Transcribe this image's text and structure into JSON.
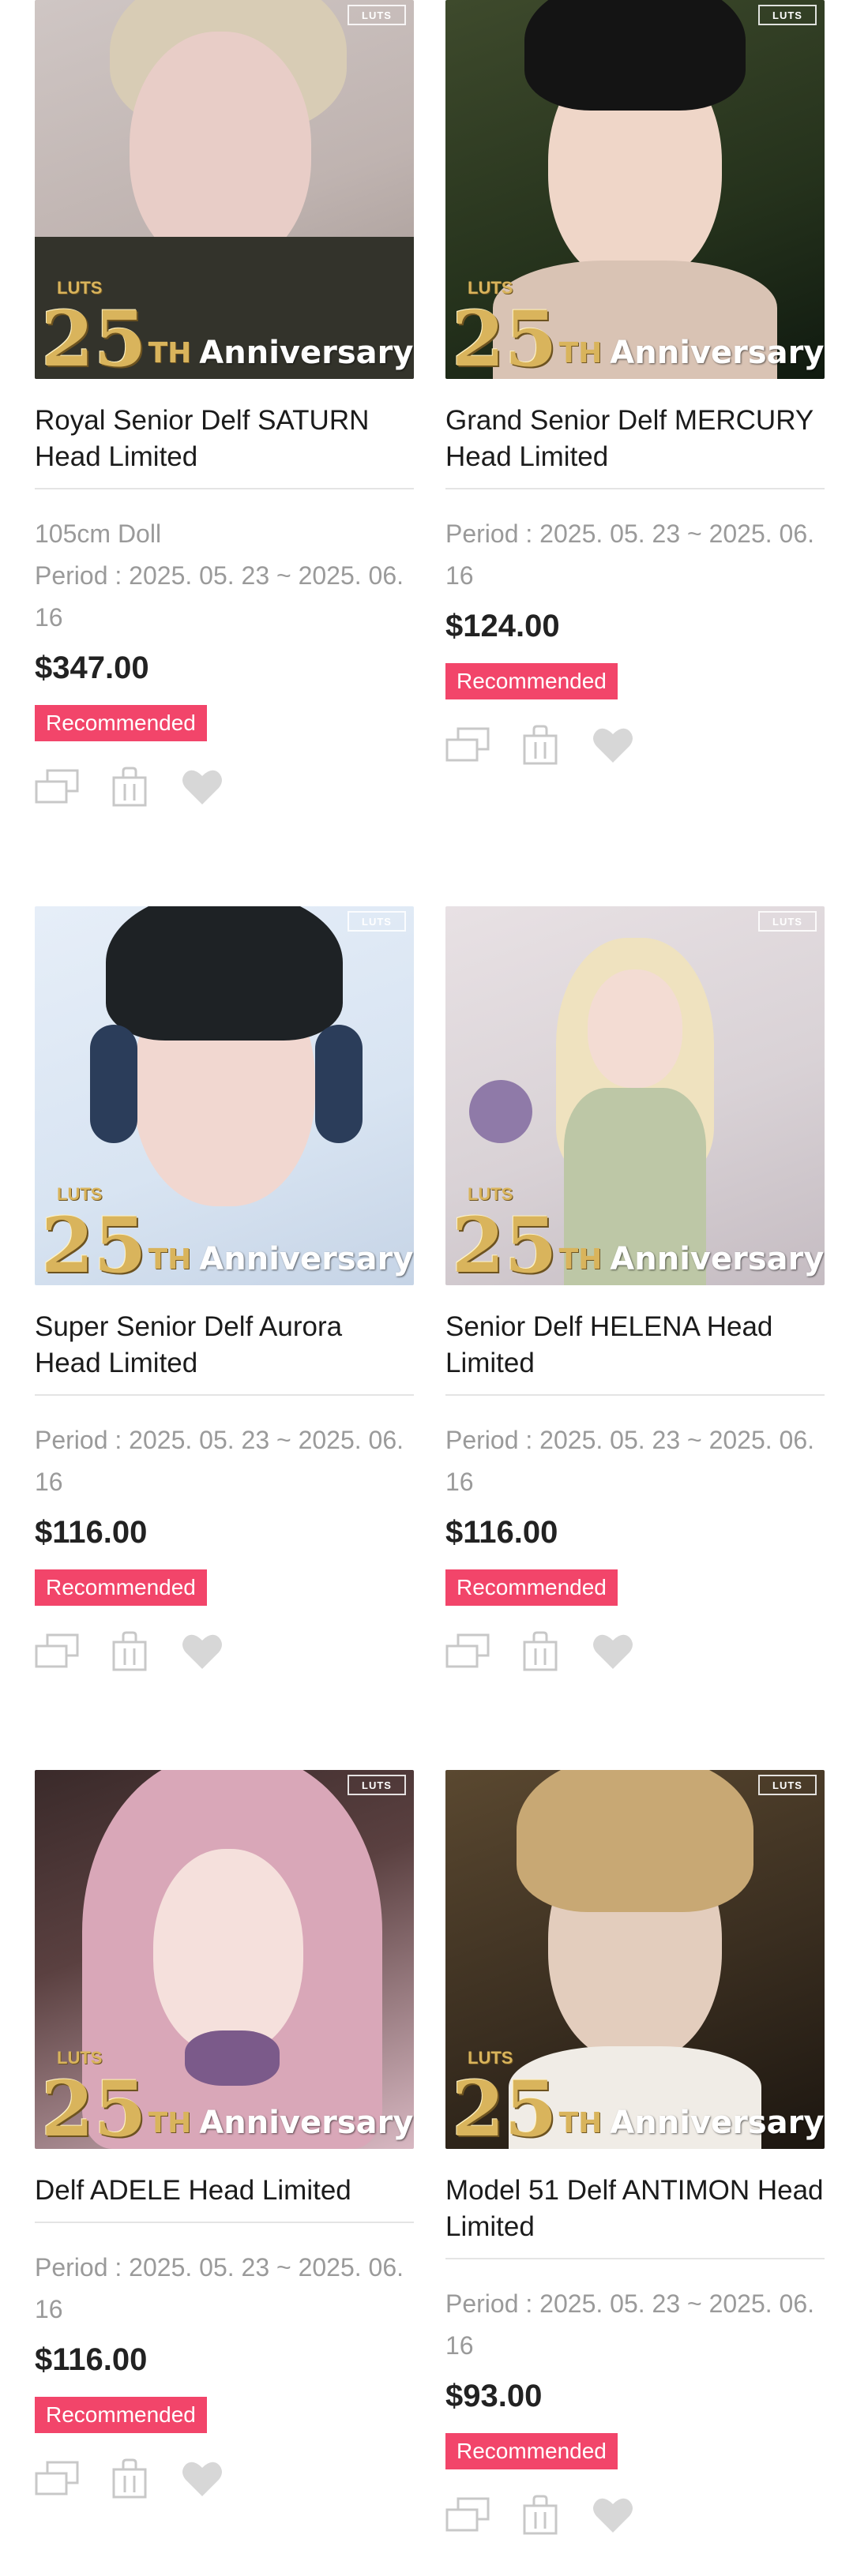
{
  "colors": {
    "recommended_badge": "#f2456a",
    "anniversary_gold": "#d9b45c",
    "icon_gray": "#c8c8c8"
  },
  "products": [
    {
      "name": "Royal Senior Delf SATURN Head Limited",
      "subtitle": "105cm Doll",
      "period": "Period : 2025. 05. 23 ~ 2025. 06. 16",
      "price": "$347.00",
      "badge": "Recommended",
      "image": {
        "brand": "LUTS",
        "anniv_number": "25",
        "anniv_suffix": "TH",
        "anniv_word": "Anniversary",
        "crown": "LUTS"
      }
    },
    {
      "name": "Grand Senior Delf MERCURY Head Limited",
      "period": "Period : 2025. 05. 23 ~ 2025. 06. 16",
      "price": "$124.00",
      "badge": "Recommended",
      "image": {
        "brand": "LUTS",
        "anniv_number": "25",
        "anniv_suffix": "TH",
        "anniv_word": "Anniversary",
        "crown": "LUTS"
      }
    },
    {
      "name": "Super Senior Delf Aurora Head Limited",
      "period": "Period : 2025. 05. 23 ~ 2025. 06. 16",
      "price": "$116.00",
      "badge": "Recommended",
      "image": {
        "brand": "LUTS",
        "anniv_number": "25",
        "anniv_suffix": "TH",
        "anniv_word": "Anniversary",
        "crown": "LUTS"
      }
    },
    {
      "name": "Senior Delf HELENA Head Limited",
      "period": "Period : 2025. 05. 23 ~ 2025. 06. 16",
      "price": "$116.00",
      "badge": "Recommended",
      "image": {
        "brand": "LUTS",
        "anniv_number": "25",
        "anniv_suffix": "TH",
        "anniv_word": "Anniversary",
        "crown": "LUTS"
      }
    },
    {
      "name": "Delf ADELE Head Limited",
      "period": "Period : 2025. 05. 23 ~ 2025. 06. 16",
      "price": "$116.00",
      "badge": "Recommended",
      "image": {
        "brand": "LUTS",
        "anniv_number": "25",
        "anniv_suffix": "TH",
        "anniv_word": "Anniversary",
        "crown": "LUTS"
      }
    },
    {
      "name": "Model 51 Delf ANTIMON Head Limited",
      "period": "Period : 2025. 05. 23 ~ 2025. 06. 16",
      "price": "$93.00",
      "badge": "Recommended",
      "image": {
        "brand": "LUTS",
        "anniv_number": "25",
        "anniv_suffix": "TH",
        "anniv_word": "Anniversary",
        "crown": "LUTS"
      }
    }
  ],
  "actions": {
    "icons": [
      "compare-icon",
      "cart-icon",
      "wishlist-heart-icon"
    ]
  }
}
